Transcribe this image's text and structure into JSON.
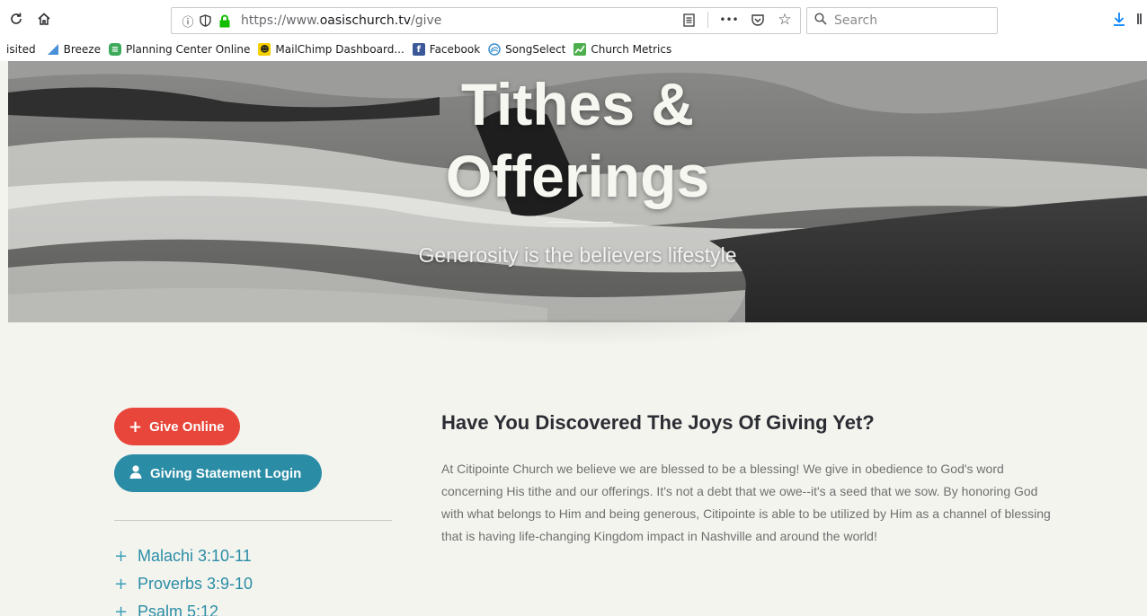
{
  "browser": {
    "url_prefix": "https://www.",
    "url_domain": "oasischurch.tv",
    "url_path": "/give",
    "search_placeholder": "Search",
    "more_label": "•••"
  },
  "bookmarks": {
    "items": [
      {
        "label": "isited",
        "icon": "none"
      },
      {
        "label": "Breeze",
        "icon": "breeze-icon",
        "color": "#4a90d9"
      },
      {
        "label": "Planning Center Online",
        "icon": "planning-center-icon",
        "color": "#3da95b"
      },
      {
        "label": "MailChimp Dashboard...",
        "icon": "mailchimp-icon",
        "color": "#f5d000"
      },
      {
        "label": "Facebook",
        "icon": "facebook-icon",
        "color": "#3b5998"
      },
      {
        "label": "SongSelect",
        "icon": "songselect-icon",
        "color": "#3a8fd0"
      },
      {
        "label": "Church Metrics",
        "icon": "church-metrics-icon",
        "color": "#4cae4c"
      }
    ]
  },
  "hero": {
    "title_line1": "Tithes &",
    "title_line2": "Offerings",
    "subtitle": "Generosity is the believers lifestyle"
  },
  "sidebar": {
    "give_online_label": "Give Online",
    "statement_login_label": "Giving Statement Login",
    "verses": [
      "Malachi 3:10-11",
      "Proverbs 3:9-10",
      "Psalm 5:12"
    ]
  },
  "main": {
    "heading": "Have You Discovered The Joys Of Giving Yet?",
    "paragraph": "At Citipointe Church we believe we are blessed to be a blessing! We give in obedience to God's word concerning His tithe and our offerings. It's not a debt that we owe--it's a seed that we sow. By honoring God with what belongs to Him and being generous, Citipointe is able to be utilized by Him as a channel of blessing that is having life-changing Kingdom impact in Nashville and around the world!"
  },
  "colors": {
    "give_button": "#e8463a",
    "login_button": "#2a8da5",
    "link": "#2a8da5",
    "page_bg": "#f4f4ef"
  }
}
